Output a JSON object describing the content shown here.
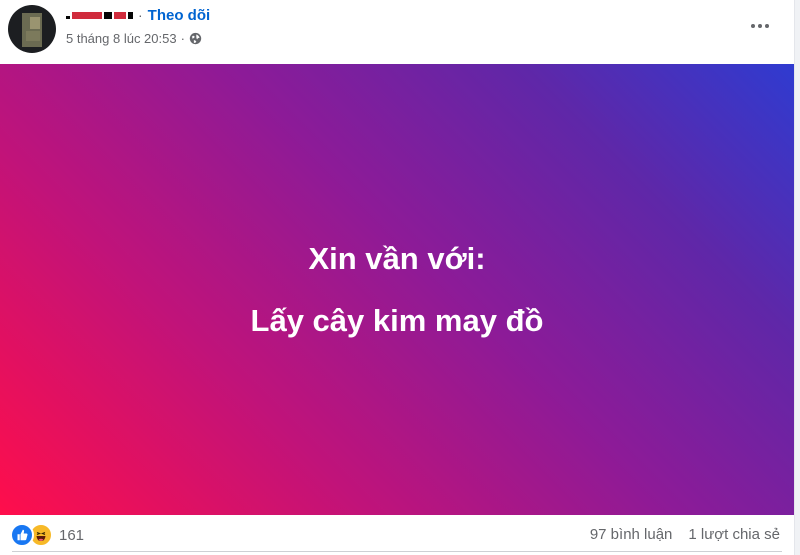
{
  "post": {
    "author": {
      "follow_label": "Theo dõi",
      "separator": "·"
    },
    "meta": {
      "timestamp": "5 tháng 8 lúc 20:53",
      "separator": "·",
      "privacy_icon": "globe-icon"
    },
    "more_icon": "more-horizontal-icon",
    "status": {
      "background": {
        "from": "#ff0e4b",
        "to": "#2f3bd0"
      },
      "lines": [
        "Xin vần với:",
        "Lấy cây kim may đồ"
      ]
    },
    "footer": {
      "reaction_icons": [
        "like-icon",
        "haha-icon"
      ],
      "reaction_count": "161",
      "comments": "97 bình luận",
      "shares": "1 lượt chia sẻ"
    }
  }
}
